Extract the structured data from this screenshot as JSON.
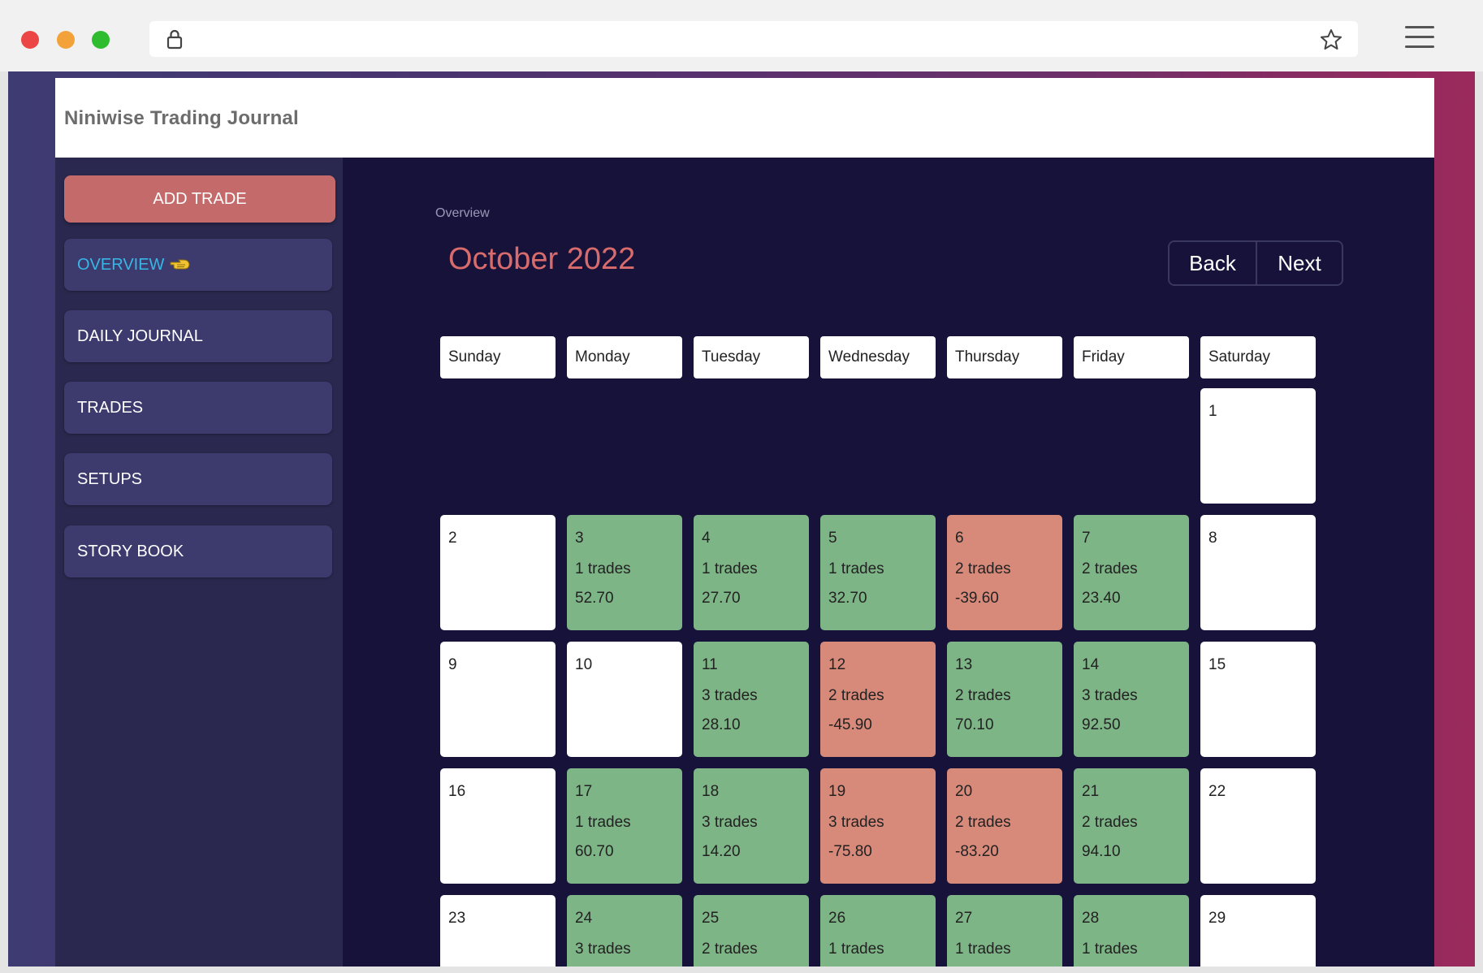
{
  "browser": {
    "lock_icon": "lock-icon",
    "bookmark_icon": "star-icon",
    "menu_icon": "hamburger-icon",
    "colors": {
      "close": "#ec4545",
      "minimize": "#f3a23a",
      "maximize": "#2fbd2f"
    }
  },
  "app": {
    "title": "Niniwise Trading Journal",
    "colors": {
      "background": "#17123a",
      "sidebar": "#2a284e",
      "nav_item": "#3d3a6e",
      "accent_red": "#d86b6b",
      "profit": "#7eb586",
      "loss": "#d88a7a",
      "active_link": "#38b6e6"
    }
  },
  "sidebar": {
    "add_trade_label": "ADD TRADE",
    "items": [
      {
        "label": "OVERVIEW",
        "active": true,
        "icon": "pointing-hand-icon"
      },
      {
        "label": "DAILY JOURNAL",
        "active": false
      },
      {
        "label": "TRADES",
        "active": false
      },
      {
        "label": "SETUPS",
        "active": false
      },
      {
        "label": "STORY BOOK",
        "active": false
      }
    ]
  },
  "main": {
    "breadcrumb": "Overview",
    "month_title": "October 2022",
    "back_label": "Back",
    "next_label": "Next"
  },
  "calendar": {
    "weekdays": [
      "Sunday",
      "Monday",
      "Tuesday",
      "Wednesday",
      "Thursday",
      "Friday",
      "Saturday"
    ],
    "first_weekday_index": 6,
    "days": [
      {
        "day": "1"
      },
      {
        "day": "2"
      },
      {
        "day": "3",
        "trades": "1 trades",
        "pnl": "52.70",
        "status": "profit"
      },
      {
        "day": "4",
        "trades": "1 trades",
        "pnl": "27.70",
        "status": "profit"
      },
      {
        "day": "5",
        "trades": "1 trades",
        "pnl": "32.70",
        "status": "profit"
      },
      {
        "day": "6",
        "trades": "2 trades",
        "pnl": "-39.60",
        "status": "loss"
      },
      {
        "day": "7",
        "trades": "2 trades",
        "pnl": "23.40",
        "status": "profit"
      },
      {
        "day": "8"
      },
      {
        "day": "9"
      },
      {
        "day": "10"
      },
      {
        "day": "11",
        "trades": "3 trades",
        "pnl": "28.10",
        "status": "profit"
      },
      {
        "day": "12",
        "trades": "2 trades",
        "pnl": "-45.90",
        "status": "loss"
      },
      {
        "day": "13",
        "trades": "2 trades",
        "pnl": "70.10",
        "status": "profit"
      },
      {
        "day": "14",
        "trades": "3 trades",
        "pnl": "92.50",
        "status": "profit"
      },
      {
        "day": "15"
      },
      {
        "day": "16"
      },
      {
        "day": "17",
        "trades": "1 trades",
        "pnl": "60.70",
        "status": "profit"
      },
      {
        "day": "18",
        "trades": "3 trades",
        "pnl": "14.20",
        "status": "profit"
      },
      {
        "day": "19",
        "trades": "3 trades",
        "pnl": "-75.80",
        "status": "loss"
      },
      {
        "day": "20",
        "trades": "2 trades",
        "pnl": "-83.20",
        "status": "loss"
      },
      {
        "day": "21",
        "trades": "2 trades",
        "pnl": "94.10",
        "status": "profit"
      },
      {
        "day": "22"
      },
      {
        "day": "23"
      },
      {
        "day": "24",
        "trades": "3 trades",
        "status": "profit"
      },
      {
        "day": "25",
        "trades": "2 trades",
        "status": "profit"
      },
      {
        "day": "26",
        "trades": "1 trades",
        "status": "profit"
      },
      {
        "day": "27",
        "trades": "1 trades",
        "status": "profit"
      },
      {
        "day": "28",
        "trades": "1 trades",
        "status": "profit"
      },
      {
        "day": "29"
      }
    ]
  }
}
